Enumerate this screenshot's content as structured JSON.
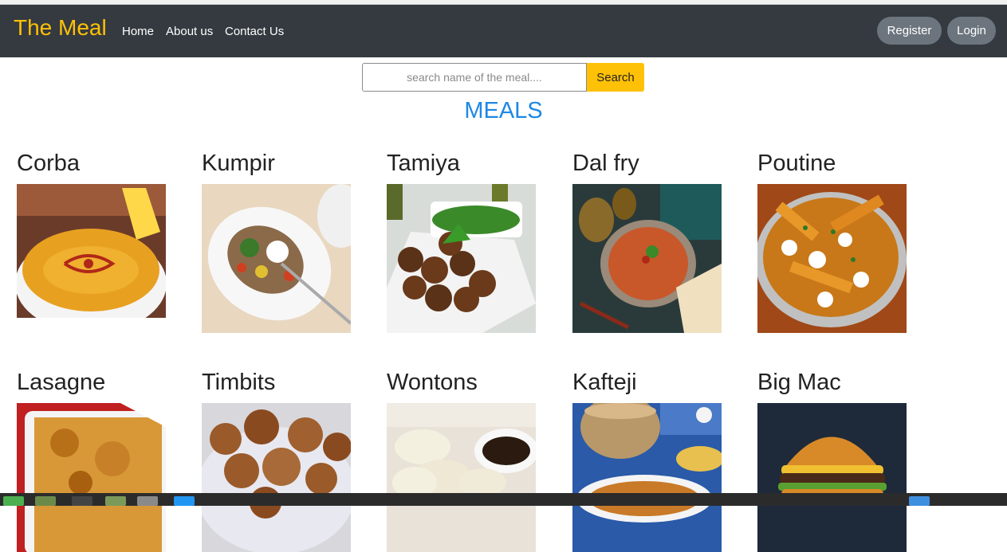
{
  "navbar": {
    "brand": "The Meal",
    "links": [
      "Home",
      "About us",
      "Contact Us"
    ],
    "register": "Register",
    "login": "Login"
  },
  "search": {
    "placeholder": "search name of the meal....",
    "value": "",
    "button": "Search"
  },
  "heading": "MEALS",
  "meals": [
    {
      "name": "Corba",
      "image_icon": "soup-bowl-photo"
    },
    {
      "name": "Kumpir",
      "image_icon": "baked-potato-photo"
    },
    {
      "name": "Tamiya",
      "image_icon": "falafel-photo"
    },
    {
      "name": "Dal fry",
      "image_icon": "dal-curry-photo"
    },
    {
      "name": "Poutine",
      "image_icon": "poutine-photo"
    },
    {
      "name": "Lasagne",
      "image_icon": "lasagne-photo"
    },
    {
      "name": "Timbits",
      "image_icon": "donut-holes-photo"
    },
    {
      "name": "Wontons",
      "image_icon": "wontons-photo"
    },
    {
      "name": "Kafteji",
      "image_icon": "kafteji-photo"
    },
    {
      "name": "Big Mac",
      "image_icon": "burger-photo"
    }
  ],
  "colors": {
    "navbar": "#343a40",
    "brand": "#ffc107",
    "accent_button": "#ffc107",
    "heading": "#1e88e5",
    "pill": "#6c757d"
  }
}
